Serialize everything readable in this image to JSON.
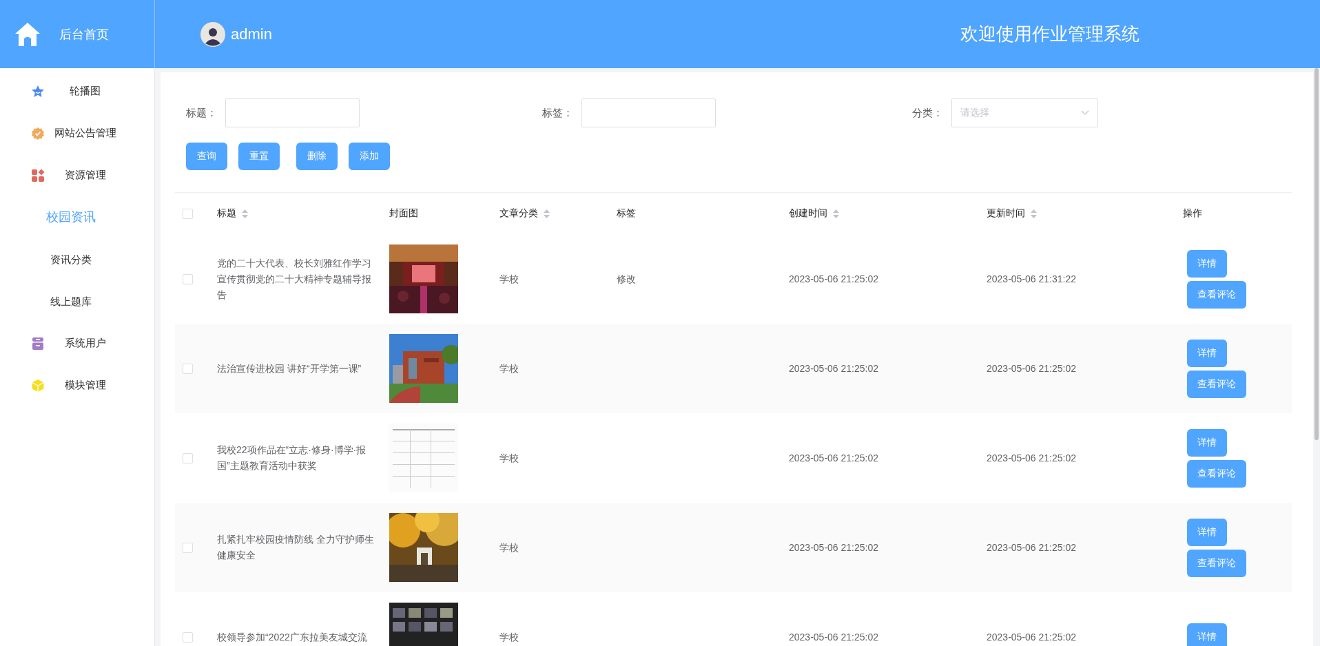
{
  "sidebar": {
    "brand": "后台首页",
    "items": [
      {
        "label": "轮播图",
        "kind": "star",
        "selected": false
      },
      {
        "label": "网站公告管理",
        "kind": "badge",
        "selected": false
      },
      {
        "label": "资源管理",
        "kind": "grid",
        "selected": false,
        "expanded": true,
        "children": [
          {
            "label": "校园资讯",
            "selected": true
          },
          {
            "label": "资讯分类",
            "selected": false
          },
          {
            "label": "线上题库",
            "selected": false
          }
        ]
      },
      {
        "label": "系统用户",
        "kind": "box",
        "selected": false
      },
      {
        "label": "模块管理",
        "kind": "cube",
        "selected": false
      }
    ]
  },
  "header": {
    "user": "admin",
    "title": "欢迎使用作业管理系统"
  },
  "filters": [
    {
      "label": "标题：",
      "kind": "input"
    },
    {
      "label": "标签：",
      "kind": "input"
    },
    {
      "label": "分类：",
      "kind": "select",
      "placeholder": "请选择"
    }
  ],
  "buttons": [
    "查询",
    "重置",
    "删除",
    "添加"
  ],
  "table": {
    "all_checked": false,
    "columns": [
      {
        "label": "标题",
        "sortable": true
      },
      {
        "label": "封面图",
        "sortable": false
      },
      {
        "label": "文章分类",
        "sortable": true
      },
      {
        "label": "标签",
        "sortable": false
      },
      {
        "label": "创建时间",
        "sortable": true
      },
      {
        "label": "更新时间",
        "sortable": true
      },
      {
        "label": "操作",
        "sortable": false
      }
    ],
    "rows": [
      {
        "checked": false,
        "title": "党的二十大代表、校长刘雅红作学习宣传贯彻党的二十大精神专题辅导报告",
        "category": "学校",
        "tag": "修改",
        "created": "2023-05-06 21:25:02",
        "updated": "2023-05-06 21:31:22",
        "actions": [
          "详情",
          "查看评论"
        ]
      },
      {
        "checked": false,
        "title": "法治宣传进校园 讲好“开学第一课”",
        "category": "学校",
        "created": "2023-05-06 21:25:02",
        "updated": "2023-05-06 21:25:02",
        "actions": [
          "详情",
          "查看评论"
        ]
      },
      {
        "checked": false,
        "title": "我校22项作品在“立志·修身·博学·报国”主题教育活动中获奖",
        "category": "学校",
        "created": "2023-05-06 21:25:02",
        "updated": "2023-05-06 21:25:02",
        "actions": [
          "详情",
          "查看评论"
        ]
      },
      {
        "checked": false,
        "title": "扎紧扎牢校园疫情防线 全力守护师生健康安全",
        "category": "学校",
        "created": "2023-05-06 21:25:02",
        "updated": "2023-05-06 21:25:02",
        "actions": [
          "详情",
          "查看评论"
        ]
      },
      {
        "checked": false,
        "title": "校领导参加“2022广东拉美友城交流",
        "category": "学校",
        "created": "2023-05-06 21:25:02",
        "updated": "2023-05-06 21:25:02",
        "actions": [
          "详情"
        ]
      }
    ]
  }
}
